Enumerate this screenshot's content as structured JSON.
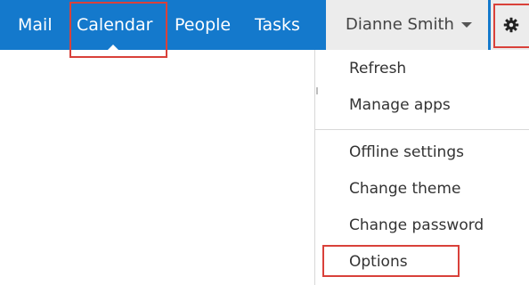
{
  "nav": {
    "items": [
      {
        "label": "Mail"
      },
      {
        "label": "Calendar"
      },
      {
        "label": "People"
      },
      {
        "label": "Tasks"
      }
    ],
    "active": "Calendar"
  },
  "user": {
    "name": "Dianne Smith",
    "caret_icon": "chevron-down-icon"
  },
  "settings": {
    "icon": "gear-icon"
  },
  "menu": {
    "groups": [
      {
        "items": [
          {
            "label": "Refresh"
          },
          {
            "label": "Manage apps"
          }
        ]
      },
      {
        "items": [
          {
            "label": "Offline settings"
          },
          {
            "label": "Change theme"
          },
          {
            "label": "Change password"
          },
          {
            "label": "Options"
          }
        ]
      }
    ]
  },
  "colors": {
    "bar": "#1479cc",
    "user_area": "#ececec",
    "highlight": "#d9413a",
    "menu_text": "#333333"
  }
}
